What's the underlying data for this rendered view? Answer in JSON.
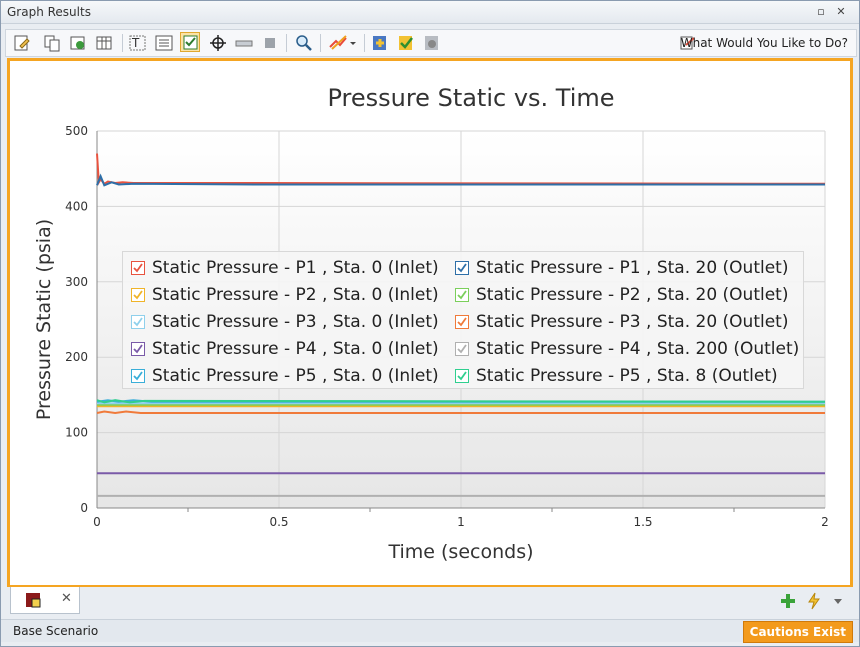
{
  "window": {
    "title": "Graph Results"
  },
  "toolbar": {
    "icons": [
      "edit-icon",
      "copy-icon",
      "export-icon",
      "table-icon",
      "text-icon",
      "legend-icon",
      "checkbox-icon",
      "crosshair-icon",
      "slider-icon",
      "stop-icon",
      "zoom-icon",
      "graph-style-icon",
      "add-graph-icon",
      "check-graph-icon",
      "info-icon"
    ],
    "what_would_you_like": "What Would You Like to Do?"
  },
  "chart_data": {
    "type": "line",
    "title": "Pressure Static vs. Time",
    "xlabel": "Time (seconds)",
    "ylabel": "Pressure Static (psia)",
    "xlim": [
      0,
      2
    ],
    "ylim": [
      0,
      500
    ],
    "x_ticks": [
      "0",
      "0.5",
      "1",
      "1.5",
      "2"
    ],
    "y_ticks": [
      "0",
      "100",
      "200",
      "300",
      "400",
      "500"
    ],
    "grid": true,
    "legend_position": "center-left",
    "series": [
      {
        "name": "Static Pressure - P1 , Sta. 0 (Inlet)",
        "color": "#e8533f",
        "x": [
          0,
          0.005,
          0.01,
          0.02,
          0.03,
          0.05,
          0.07,
          0.1,
          0.35,
          2
        ],
        "y": [
          470,
          432,
          436,
          430,
          433,
          431,
          432,
          431,
          431,
          430
        ]
      },
      {
        "name": "Static Pressure - P1 , Sta. 20 (Outlet)",
        "color": "#2e6fa8",
        "x": [
          0,
          0.01,
          0.02,
          0.04,
          0.06,
          0.1,
          0.45,
          2
        ],
        "y": [
          428,
          440,
          428,
          432,
          429,
          430,
          429,
          429
        ]
      },
      {
        "name": "Static Pressure - P2 , Sta. 0 (Inlet)",
        "color": "#f0b429",
        "x": [
          0,
          2
        ],
        "y": [
          135,
          135
        ]
      },
      {
        "name": "Static Pressure - P2 , Sta. 20 (Outlet)",
        "color": "#7bcf5b",
        "x": [
          0,
          2
        ],
        "y": [
          137,
          137
        ]
      },
      {
        "name": "Static Pressure - P3 , Sta. 0 (Inlet)",
        "color": "#8fd0ec",
        "x": [
          0,
          2
        ],
        "y": [
          139,
          139
        ]
      },
      {
        "name": "Static Pressure - P3 , Sta. 20 (Outlet)",
        "color": "#f07a3a",
        "x": [
          0,
          0.02,
          0.05,
          0.08,
          0.12,
          2
        ],
        "y": [
          126,
          128,
          126,
          128,
          126,
          126
        ]
      },
      {
        "name": "Static Pressure - P4 , Sta. 0 (Inlet)",
        "color": "#7a5aa8",
        "x": [
          0,
          2
        ],
        "y": [
          46,
          46
        ]
      },
      {
        "name": "Static Pressure - P4 , Sta. 200 (Outlet)",
        "color": "#b0b0b0",
        "x": [
          0,
          2
        ],
        "y": [
          16,
          16
        ]
      },
      {
        "name": "Static Pressure - P5 , Sta. 0 (Inlet)",
        "color": "#3aaed8",
        "x": [
          0,
          0.03,
          0.06,
          0.1,
          0.15,
          2
        ],
        "y": [
          141,
          143,
          141,
          143,
          141,
          141
        ]
      },
      {
        "name": "Static Pressure - P5 , Sta. 8 (Outlet)",
        "color": "#2fcf8f",
        "x": [
          0,
          0.02,
          0.05,
          0.09,
          0.13,
          2
        ],
        "y": [
          143,
          140,
          143,
          140,
          142,
          141
        ]
      }
    ]
  },
  "tabs": {
    "close_symbol": "✕"
  },
  "status": {
    "scenario": "Base Scenario",
    "cautions": "Cautions Exist"
  }
}
